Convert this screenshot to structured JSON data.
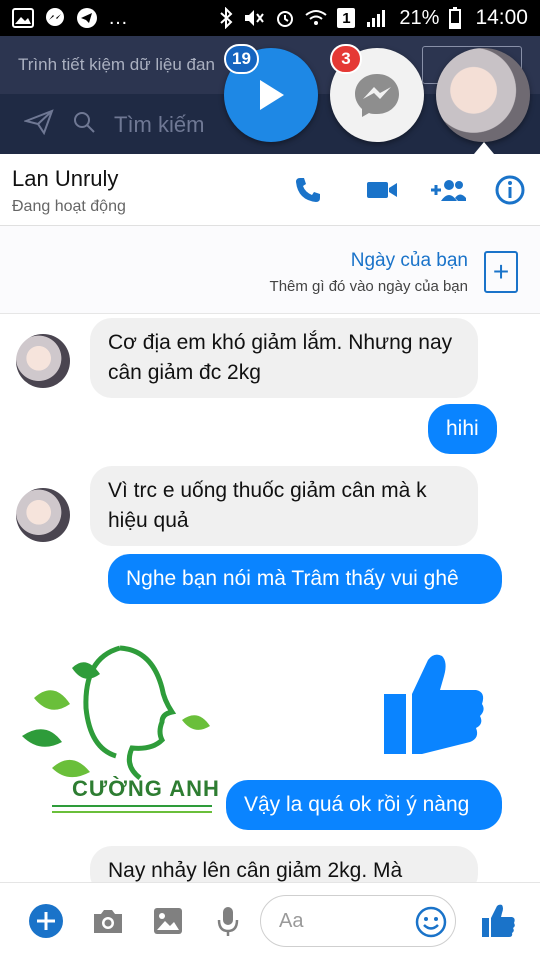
{
  "status_bar": {
    "battery": "21%",
    "time": "14:00",
    "sim": "1"
  },
  "background": {
    "banner_text": "Trình tiết kiệm dữ liệu đan",
    "search_placeholder": "Tìm kiếm"
  },
  "chat_heads": {
    "play_badge": "19",
    "messenger_badge": "3"
  },
  "header": {
    "contact_name": "Lan Unruly",
    "contact_status": "Đang hoạt động"
  },
  "day": {
    "title": "Ngày của bạn",
    "subtitle": "Thêm gì đó vào ngày của bạn"
  },
  "messages": [
    {
      "side": "in",
      "text": "Cơ địa em khó giảm lắm. Nhưng nay cân giảm đc 2kg"
    },
    {
      "side": "out",
      "text": "hihi"
    },
    {
      "side": "in",
      "text": "Vì trc e uống thuốc giảm cân mà k hiệu quả"
    },
    {
      "side": "out",
      "text": "Nghe bạn nói mà Trâm thấy vui ghê"
    },
    {
      "side": "out",
      "text": "Vậy la quá ok rồi ý nàng"
    },
    {
      "side": "in",
      "text": "Nay nhảy lên cân giảm 2kg. Mà"
    }
  ],
  "watermark": {
    "brand_text": "CƯỜNG ANH"
  },
  "composer": {
    "placeholder": "Aa"
  },
  "colors": {
    "accent": "#0a84ff",
    "link": "#1a73c9"
  }
}
